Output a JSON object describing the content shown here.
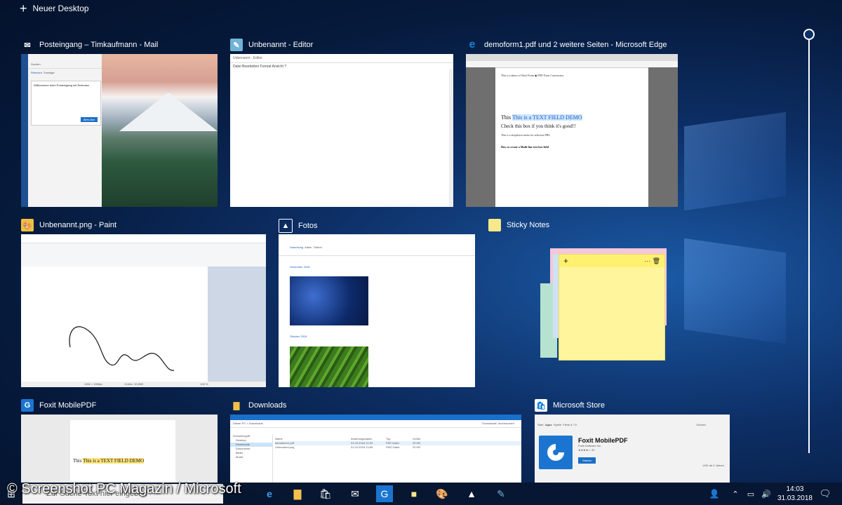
{
  "top": {
    "new_desktop": "Neuer Desktop"
  },
  "windows": {
    "mail": {
      "title": "Posteingang – Timkaufmann - Mail",
      "tabs": [
        "Relevant",
        "Sonstige"
      ],
      "search": "Suchen",
      "popup_title": "Willkommen beim Posteingang mit Relevanz",
      "popup_button": "Alles klar"
    },
    "editor": {
      "title": "Unbenannt - Editor",
      "titlebar": "Unbenannt - Editor",
      "menu": "Datei  Bearbeiten  Format  Ansicht  ?"
    },
    "edge": {
      "title": "demoform1.pdf und 2 weitere Seiten - Microsoft Edge",
      "intro": "This is a demo of Word Form ◆ PDF Form Conversion.",
      "field_prefix": "This",
      "field_text": "This is a TEXT FIELD DEMO",
      "checkbox_text": "Check this box if you think it's good!!",
      "dropdown_text": "This is a dropdown menu for selection  PRS",
      "multiline_title": "How to create a Multi-line text box field"
    },
    "paint": {
      "title": "Unbenannt.png - Paint",
      "status_size": "1158 × 1080px",
      "status_file": "Größe: 10,8KB",
      "zoom": "100 %"
    },
    "fotos": {
      "title": "Fotos",
      "tabs": [
        "Sammlung",
        "Alben",
        "Ordner"
      ],
      "section1": "Dezember 2018",
      "section2": "Oktober 2018"
    },
    "sticky": {
      "title": "Sticky Notes"
    },
    "foxit": {
      "title": "Foxit MobilePDF",
      "field_prefix": "This",
      "field_text": "This is a TEXT FIELD DEMO"
    },
    "downloads": {
      "title": "Downloads",
      "path": "Dieser PC > Downloads",
      "search": "\"Downloads\" durchsuchen",
      "columns": [
        "Name",
        "Änderungsdatum",
        "Typ",
        "Größe"
      ],
      "files": [
        {
          "name": "demoform1.pdf",
          "date": "31.03.2018 12:23",
          "type": "PDF-Datei",
          "size": "20 KB"
        },
        {
          "name": "Unbenannt.png",
          "date": "31.03.2018 13:59",
          "type": "PNG-Datei",
          "size": "20 KB"
        }
      ],
      "nav": [
        "Schnellzugriff",
        "Desktop",
        "Downloads",
        "Dokumente",
        "Bilder",
        "Musik"
      ]
    },
    "store": {
      "title": "Microsoft Store",
      "nav": [
        "Start",
        "Apps",
        "Spiele",
        "Filme & TV"
      ],
      "search": "Suchen",
      "app_name": "Foxit MobilePDF",
      "publisher": "Foxit Software Inc.",
      "rating": "★★★★☆ 92",
      "install": "Starten",
      "age": "USK ab 0 Jahren"
    }
  },
  "taskbar": {
    "search_placeholder": "Zur Suche Text hier eingeben",
    "time": "14:03",
    "date": "31.03.2018"
  },
  "watermark": "© Screenshot PC Magazin / Microsoft"
}
